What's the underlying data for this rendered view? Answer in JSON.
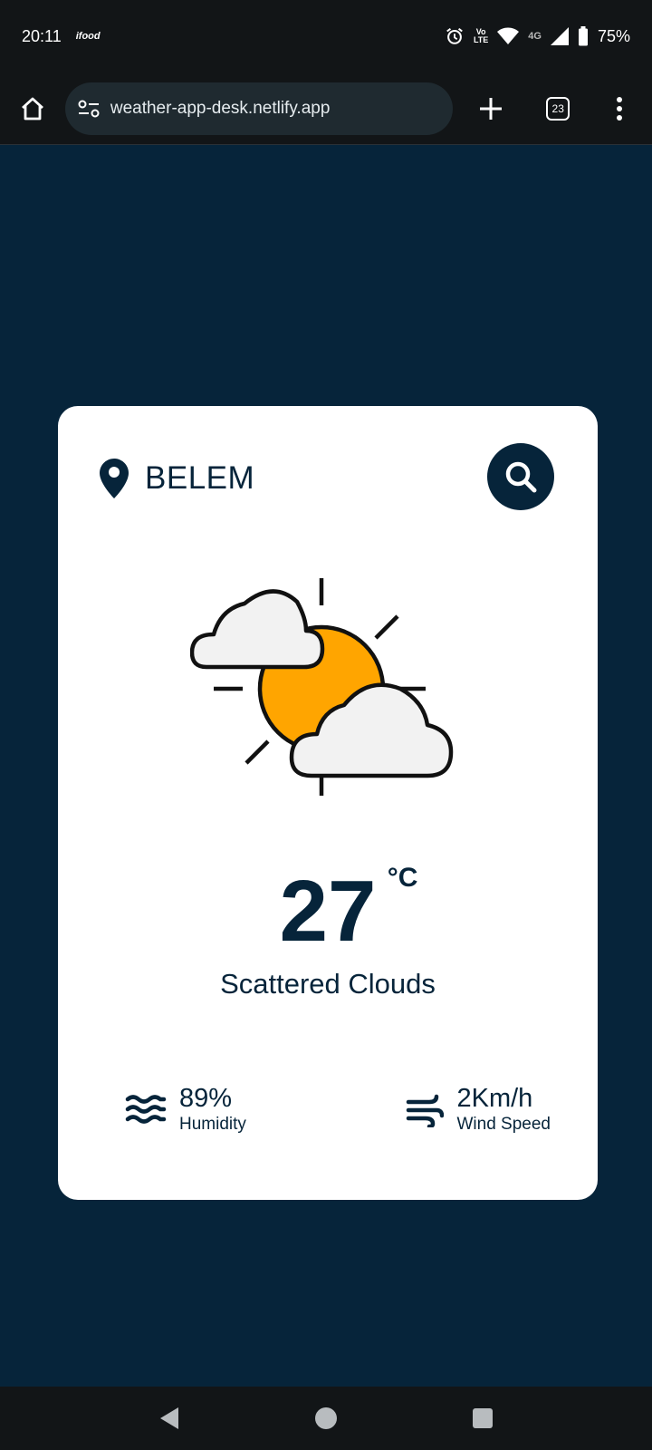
{
  "status_bar": {
    "time": "20:11",
    "app_label": "ifood",
    "volte_top": "Vo",
    "volte_bottom": "LTE",
    "network": "4G",
    "battery": "75%"
  },
  "browser": {
    "url": "weather-app-desk.netlify.app",
    "tab_count": "23"
  },
  "weather": {
    "city": "BELEM",
    "icon": "partly-cloudy-icon",
    "temperature": "27",
    "unit": "°C",
    "description": "Scattered Clouds",
    "humidity_value": "89%",
    "humidity_label": "Humidity",
    "wind_value": "2Km/h",
    "wind_label": "Wind Speed"
  },
  "colors": {
    "page_bg": "#06243a",
    "card_bg": "#ffffff",
    "text": "#06243a",
    "sun": "#ffa500",
    "cloud": "#f2f2f2"
  }
}
